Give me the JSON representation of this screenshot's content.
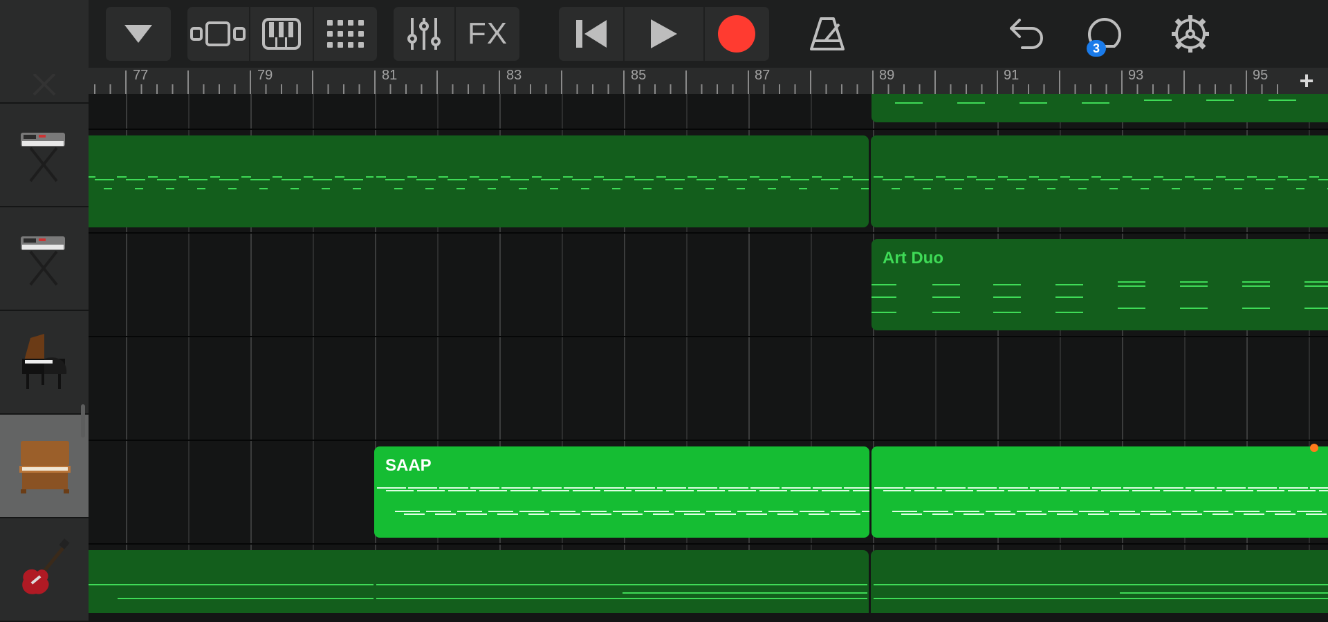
{
  "toolbar": {
    "browser_icon": "triangle-down-icon",
    "view_tracks_icon": "tracks-view-icon",
    "keyboard_icon": "piano-keyboard-icon",
    "grid_icon": "grid-icon",
    "mixer_icon": "sliders-icon",
    "fx_label": "FX",
    "rewind_icon": "skip-back-icon",
    "play_icon": "play-icon",
    "record_icon": "record-icon",
    "metronome_icon": "metronome-icon",
    "undo_icon": "undo-icon",
    "loop_icon": "loop-icon",
    "loop_badge": "3",
    "settings_icon": "gear-icon"
  },
  "ruler": {
    "bars": [
      "77",
      "79",
      "81",
      "83",
      "85",
      "87",
      "89",
      "91",
      "93",
      "95"
    ],
    "add_label": "+"
  },
  "tracks": [
    {
      "instrument": "synth-keyboard-icon"
    },
    {
      "instrument": "synth-keyboard-icon"
    },
    {
      "instrument": "synth-keyboard-icon"
    },
    {
      "instrument": "grand-piano-icon"
    },
    {
      "instrument": "upright-piano-icon",
      "selected": true
    },
    {
      "instrument": "electric-guitar-icon"
    }
  ],
  "regions": {
    "art_duo": "Art Duo",
    "saap": "SAAP"
  },
  "colors": {
    "region_dark": "#135e1c",
    "region_bright": "#15bd33",
    "record": "#ff3b30",
    "badge": "#1a7bea",
    "playhead": "#ff7a1c"
  }
}
